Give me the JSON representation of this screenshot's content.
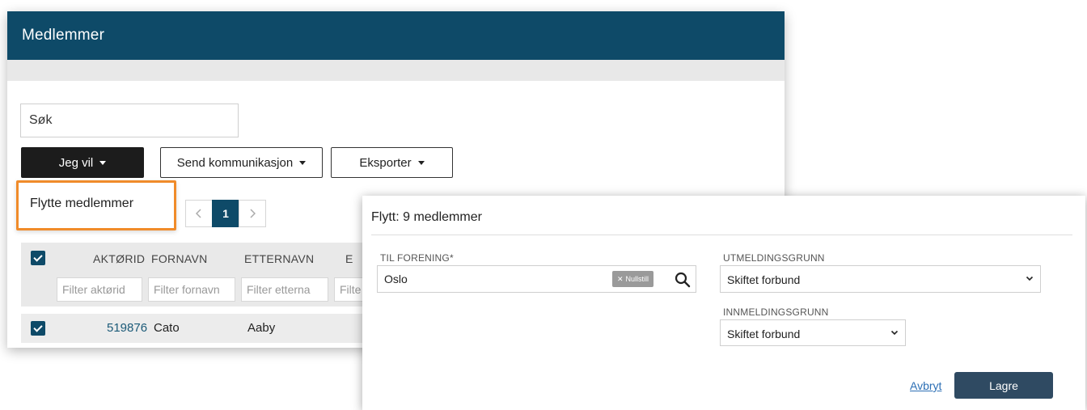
{
  "window": {
    "title": "Medlemmer",
    "search": {
      "placeholder": "Søk"
    },
    "toolbar": {
      "action_label": "Jeg vil",
      "send_label": "Send kommunikasjon",
      "export_label": "Eksporter"
    },
    "dropdown": {
      "item": "Flytte medlemmer"
    },
    "pagination": {
      "current": "1"
    },
    "table": {
      "columns": [
        "AKTØRID",
        "FORNAVN",
        "ETTERNAVN",
        "E"
      ],
      "filters": [
        "Filter aktørid",
        "Filter fornavn",
        "Filter etterna",
        "Filte"
      ],
      "rows": [
        {
          "aktorid": "519876",
          "fornavn": "Cato",
          "etternavn": "Aaby"
        }
      ]
    }
  },
  "dialog": {
    "title": "Flytt: 9 medlemmer",
    "til_forening": {
      "label": "TIL FORENING*",
      "value": "Oslo",
      "reset_label": "Nullstill"
    },
    "utmeldingsgrunn": {
      "label": "UTMELDINGSGRUNN",
      "value": "Skiftet forbund"
    },
    "innmeldingsgrunn": {
      "label": "INNMELDINGSGRUNN",
      "value": "Skiftet forbund"
    },
    "cancel_label": "Avbryt",
    "save_label": "Lagre"
  },
  "colors": {
    "header": "#0e4a68",
    "highlight": "#f08b2a",
    "save_button": "#2f4a62"
  }
}
